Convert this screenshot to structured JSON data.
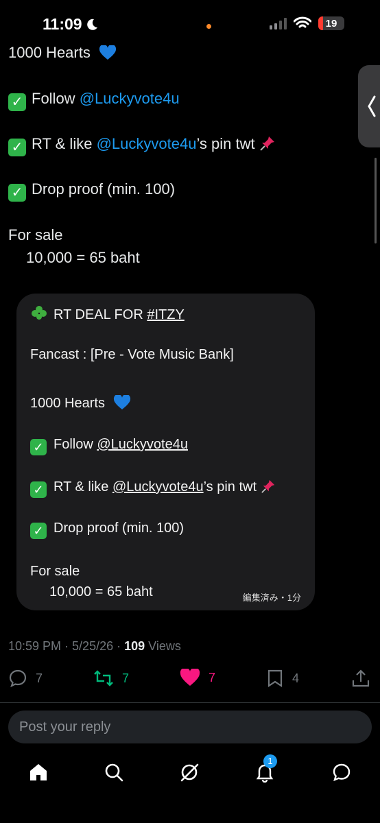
{
  "status_bar": {
    "time": "11:09",
    "battery": "19"
  },
  "tweet": {
    "hearts_line": "1000 Hearts",
    "follow_label": "Follow",
    "follow_handle": "@Luckyvote4u",
    "rt_prefix": "RT & like",
    "rt_handle": "@Luckyvote4u",
    "rt_suffix": "’s pin twt",
    "drop_proof": "Drop proof (min. 100)",
    "for_sale": "For sale",
    "price": "10,000 = 65 baht"
  },
  "card": {
    "title_prefix": "RT DEAL FOR",
    "title_tag": "#ITZY",
    "fancast": "Fancast :  [Pre - Vote Music Bank]",
    "hearts_line": "1000 Hearts",
    "follow_label": "Follow",
    "follow_handle": "@Luckyvote4u",
    "rt_prefix": "RT & like",
    "rt_handle": "@Luckyvote4u",
    "rt_suffix": "’s pin twt",
    "drop_proof": "Drop proof (min. 100)",
    "for_sale": "For sale",
    "price": "10,000 = 65 baht",
    "edited": "編集済み・1分"
  },
  "meta": {
    "datetime": "10:59 PM · 5/25/26 · ",
    "views_count": "109",
    "views_label": " Views"
  },
  "actions": {
    "replies": "7",
    "reposts": "7",
    "likes": "7",
    "bookmarks": "4"
  },
  "reply": {
    "placeholder": "Post your reply"
  },
  "nav": {
    "notifications_badge": "1"
  },
  "colors": {
    "accent": "#1d9bf0",
    "repost": "#00ba7c",
    "like": "#f91880",
    "check": "#2fb34a"
  }
}
